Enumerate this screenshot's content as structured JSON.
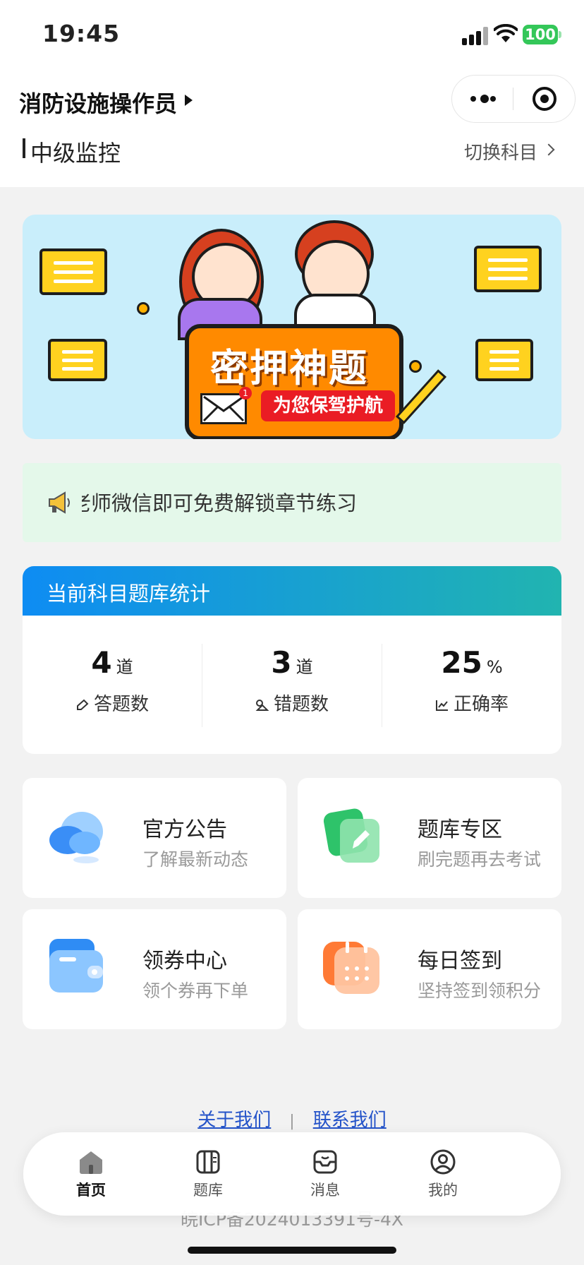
{
  "status_bar": {
    "time": "19:45",
    "battery": "100"
  },
  "header": {
    "title": "消防设施操作员",
    "level": "中级监控",
    "switch_label": "切换科目"
  },
  "banner": {
    "title": "密押神题",
    "subtitle": "为您保驾护航",
    "mail_badge": "1"
  },
  "notice": {
    "text": "老师微信即可免费解锁章节练习"
  },
  "stats": {
    "title": "当前科目题库统计",
    "items": [
      {
        "value": "4",
        "unit": "道",
        "label": "答题数",
        "icon": "pencil-icon"
      },
      {
        "value": "3",
        "unit": "道",
        "label": "错题数",
        "icon": "error-book-icon"
      },
      {
        "value": "25",
        "unit": "%",
        "label": "正确率",
        "icon": "line-chart-icon"
      }
    ]
  },
  "cards": [
    {
      "title": "官方公告",
      "desc": "了解最新动态",
      "icon": "cloud-icon",
      "color": "#3a8ef6"
    },
    {
      "title": "题库专区",
      "desc": "刷完题再去考试",
      "icon": "edit-card-icon",
      "color": "#2ec36a"
    },
    {
      "title": "领券中心",
      "desc": "领个券再下单",
      "icon": "wallet-icon",
      "color": "#2f8cf4"
    },
    {
      "title": "每日签到",
      "desc": "坚持签到领积分",
      "icon": "calendar-icon",
      "color": "#ff7a35"
    }
  ],
  "footer": {
    "about": "关于我们",
    "separator": "|",
    "contact": "联系我们",
    "icp": "皖ICP备2024013391号-4X"
  },
  "tabs": [
    {
      "label": "首页",
      "icon": "home-icon",
      "active": true
    },
    {
      "label": "题库",
      "icon": "book-icon",
      "active": false
    },
    {
      "label": "消息",
      "icon": "message-icon",
      "active": false
    },
    {
      "label": "我的",
      "icon": "user-icon",
      "active": false
    }
  ]
}
